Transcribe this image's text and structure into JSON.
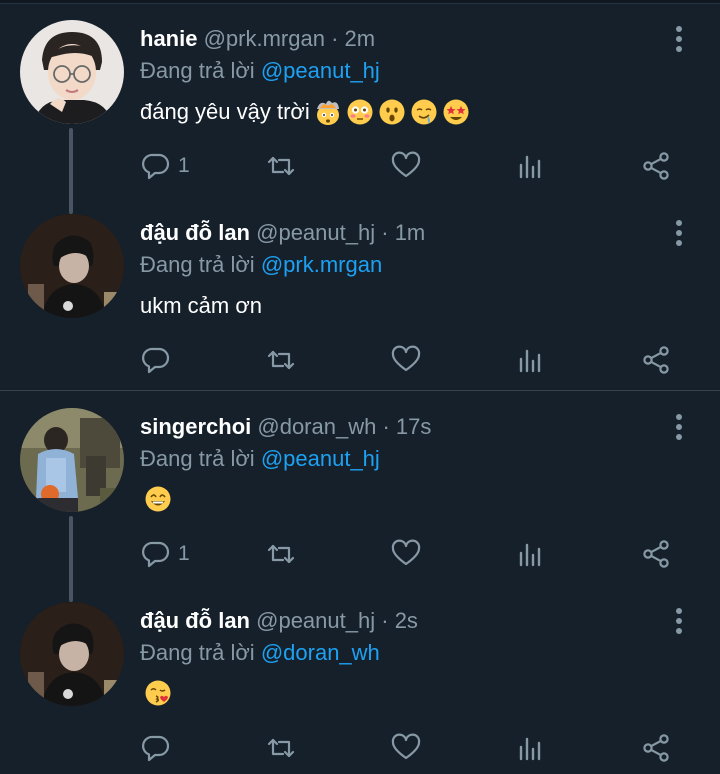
{
  "labels": {
    "replying_to": "Đang trả lời"
  },
  "colors": {
    "background": "#15202b",
    "secondary_text": "#8899a6",
    "mention": "#1da1f2",
    "icon": "#8899a6"
  },
  "tweets": [
    {
      "display_name": "hanie",
      "handle": "@prk.mrgan",
      "time": "2m",
      "reply_to": "@peanut_hj",
      "text": "đáng yêu vậy trời",
      "emojis": [
        "exploding-head",
        "flushed-face",
        "astonished-face",
        "drooling-face",
        "star-struck"
      ],
      "reply_count": "1",
      "avatar": "avatar-hanie"
    },
    {
      "display_name": "đậu đỗ lan",
      "handle": "@peanut_hj",
      "time": "1m",
      "reply_to": "@prk.mrgan",
      "text": "ukm cảm ơn",
      "emojis": [],
      "reply_count": "",
      "avatar": "avatar-peanut"
    },
    {
      "display_name": "singerchoi",
      "handle": "@doran_wh",
      "time": "17s",
      "reply_to": "@peanut_hj",
      "text": "",
      "emojis": [
        "grinning-face"
      ],
      "reply_count": "1",
      "avatar": "avatar-singerchoi"
    },
    {
      "display_name": "đậu đỗ lan",
      "handle": "@peanut_hj",
      "time": "2s",
      "reply_to": "@doran_wh",
      "text": "",
      "emojis": [
        "kissing-face"
      ],
      "reply_count": "",
      "avatar": "avatar-peanut"
    }
  ],
  "icons": {
    "reply": "reply-icon",
    "retweet": "retweet-icon",
    "like": "heart-icon",
    "analytics": "analytics-icon",
    "share": "share-icon",
    "more": "more-vertical-icon"
  }
}
